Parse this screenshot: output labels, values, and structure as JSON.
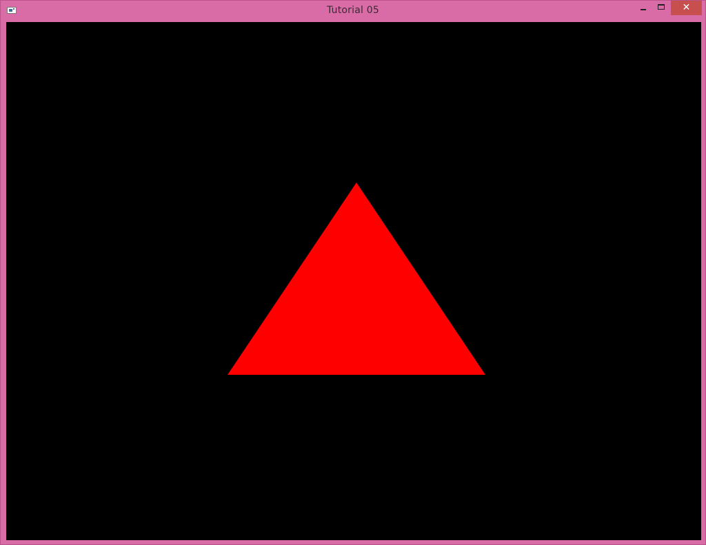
{
  "window": {
    "title": "Tutorial 05",
    "controls": {
      "minimize_icon": "minimize-icon",
      "maximize_icon": "maximize-icon",
      "close_icon": "close-icon",
      "close_glyph": "✕"
    }
  },
  "colors": {
    "frame": "#d96ba6",
    "close_button": "#c7504f",
    "clear_color": "#000000",
    "triangle_fill": "#ff0000"
  },
  "scene": {
    "shape": "triangle"
  }
}
